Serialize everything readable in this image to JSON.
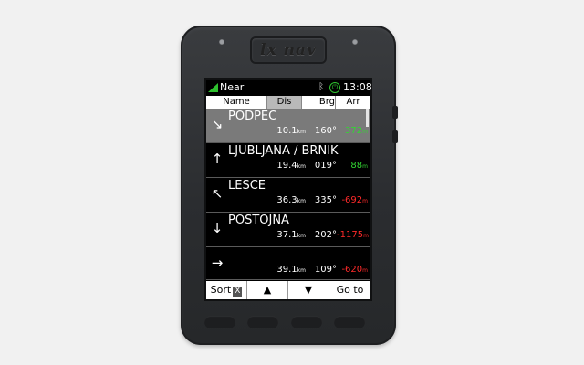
{
  "device": {
    "logo": "lx nav"
  },
  "status": {
    "title": "Near",
    "time": "13:08",
    "bluetooth_icon": "bluetooth-icon",
    "power_icon": "power-icon",
    "signal_color": "#2ec02e"
  },
  "columns": {
    "name": "Name",
    "dis": "Dis",
    "brg": "Brg",
    "arr": "Arr"
  },
  "waypoints": [
    {
      "name": "PODPEC",
      "arrow": "↘",
      "dist": "10.1",
      "dist_unit": "km",
      "brg": "160°",
      "arr": "372",
      "arr_unit": "m",
      "arr_color": "#33d633",
      "selected": true
    },
    {
      "name": "LJUBLJANA / BRNIK",
      "arrow": "↑",
      "dist": "19.4",
      "dist_unit": "km",
      "brg": "019°",
      "arr": "88",
      "arr_unit": "m",
      "arr_color": "#33d633",
      "selected": false
    },
    {
      "name": "LESCE",
      "arrow": "↖",
      "dist": "36.3",
      "dist_unit": "km",
      "brg": "335°",
      "arr": "-692",
      "arr_unit": "m",
      "arr_color": "#ff2a2a",
      "selected": false
    },
    {
      "name": "POSTOJNA",
      "arrow": "↓",
      "dist": "37.1",
      "dist_unit": "km",
      "brg": "202°",
      "arr": "-1175",
      "arr_unit": "m",
      "arr_color": "#ff2a2a",
      "selected": false
    },
    {
      "name": "",
      "arrow": "→",
      "dist": "39.1",
      "dist_unit": "km",
      "brg": "109°",
      "arr": "-620",
      "arr_unit": "m",
      "arr_color": "#ff2a2a",
      "selected": false
    }
  ],
  "bottom": {
    "sort": "Sort",
    "sort_badge": "X",
    "up": "▲",
    "down": "▼",
    "goto": "Go to"
  }
}
